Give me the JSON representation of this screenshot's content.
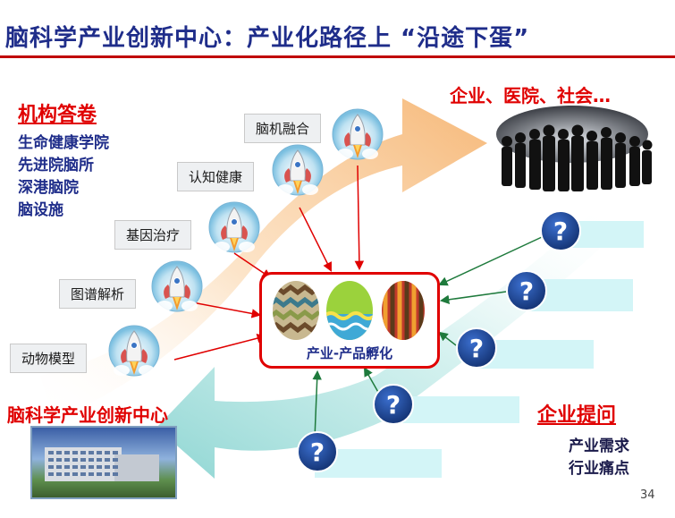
{
  "title": "脑科学产业创新中心：产业化路径上 “沿途下蛋”",
  "institutions": {
    "heading": "机构答卷",
    "items": [
      "生命健康学院",
      "先进院脑所",
      "深港脑院",
      "脑设施"
    ]
  },
  "stages": [
    "动物模型",
    "图谱解析",
    "基因治疗",
    "认知健康",
    "脑机融合"
  ],
  "society_label": "企业、医院、社会…",
  "incubator_label": "产业-产品孵化",
  "center_label": "脑科学产业创新中心",
  "enterprise": {
    "heading": "企业提问",
    "items": [
      "产业需求",
      "行业痛点"
    ]
  },
  "question_mark": "?",
  "page_number": "34",
  "colors": {
    "title": "#1f2d8a",
    "accent_red": "#e00000",
    "arrow_green": "#1e7a3c",
    "question_blue": "#1d3f8f",
    "callout_cyan": "#d3f5f7",
    "flow_orange": "#f6b878",
    "flow_teal": "#8fd6d3"
  }
}
